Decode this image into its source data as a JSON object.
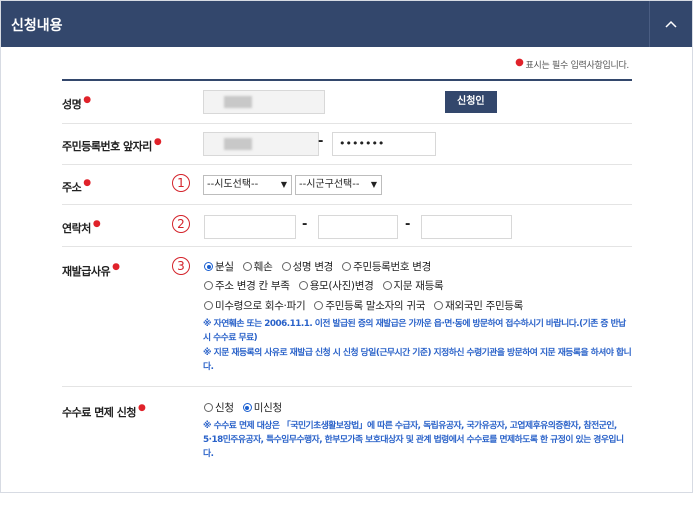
{
  "panel": {
    "title": "신청내용"
  },
  "required_note": "표시는 필수 입력사항입니다.",
  "fields": {
    "name": {
      "label": "성명",
      "button": "신청인"
    },
    "rrn": {
      "label": "주민등록번호 앞자리",
      "masked": "•••••••"
    },
    "address": {
      "label": "주소",
      "number": "1",
      "sido": "--시도선택--",
      "sigungu": "--시군구선택--"
    },
    "contact": {
      "label": "연락처",
      "number": "2"
    },
    "reason": {
      "label": "재발급사유",
      "number": "3",
      "options": [
        "분실",
        "훼손",
        "성명 변경",
        "주민등록번호 변경",
        "주소 변경 칸 부족",
        "용모(사진)변경",
        "지문 재등록",
        "미수령으로 회수·파기",
        "주민등록 말소자의 귀국",
        "재외국민 주민등록"
      ],
      "note1": "※ 자연훼손 또는 2006.11.1. 이전 발급된 증의 재발급은 가까운 읍·면·동에 방문하여 접수하시기 바랍니다.(기존 증 반납시 수수료 무료)",
      "note2": "※ 지문 재등록의 사유로 재발급 신청 시 신청 당일(근무시간 기준) 지정하신 수령기관을 방문하여 지문 재등록을 하셔야 합니다."
    },
    "fee": {
      "label": "수수료 면제 신청",
      "options": [
        "신청",
        "미신청"
      ],
      "note": "※ 수수료 면제 대상은 「국민기초생활보장법」에 따른 수급자, 독립유공자, 국가유공자, 고엽제후유의증환자, 참전군인, 5·18민주유공자, 특수임무수행자, 한부모가족 보호대상자 및 관계 법령에서 수수료를 면제하도록 한 규정이 있는 경우입니다."
    }
  },
  "colors": {
    "header": "#33476c",
    "required": "#e0222a",
    "note": "#2a62c9",
    "step": "#d4232b"
  }
}
